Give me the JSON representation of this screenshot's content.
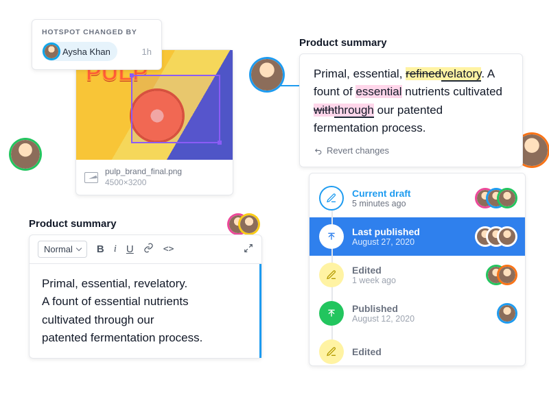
{
  "hotspot": {
    "label": "HOTSPOT CHANGED BY",
    "user": "Aysha Khan",
    "time": "1h"
  },
  "image_card": {
    "filename": "pulp_brand_final.png",
    "dimensions": "4500×3200",
    "logo_text": "PULP"
  },
  "editor_section": {
    "title": "Product summary",
    "style_select": "Normal",
    "content_l1": "Primal, essential, revelatory.",
    "content_l2": "A fount of essential nutrients",
    "content_l3": "cultivated through our",
    "content_l4": "patented fermentation process."
  },
  "diff_section": {
    "title": "Product summary",
    "t1": "Primal, essential, ",
    "del1": "refined",
    "ins1": "velatory",
    "t2": ". A fount of ",
    "hl2": "essential",
    "t3": " nutrients cultivated ",
    "del2": "with",
    "ins2": "through",
    "t4": " our patented fermentation process.",
    "revert": "Revert changes"
  },
  "timeline": [
    {
      "title": "Current draft",
      "sub": "5 minutes ago"
    },
    {
      "title": "Last published",
      "sub": "August 27, 2020"
    },
    {
      "title": "Edited",
      "sub": "1 week ago"
    },
    {
      "title": "Published",
      "sub": "August 12, 2020"
    },
    {
      "title": "Edited",
      "sub": ""
    }
  ]
}
